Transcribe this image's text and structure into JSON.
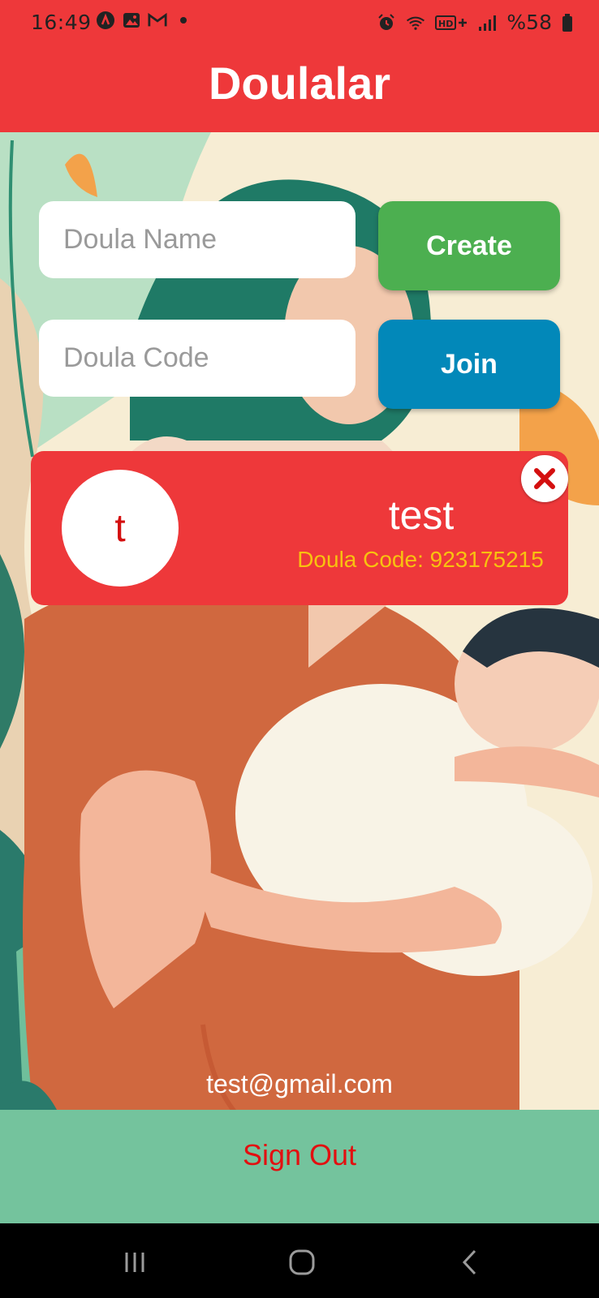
{
  "status_bar": {
    "time": "16:49",
    "battery": "%58",
    "notification_icons": [
      "app-logo-icon",
      "image-icon",
      "gmail-icon"
    ],
    "system_icons": [
      "alarm-icon",
      "wifi-icon",
      "hd-plus-icon",
      "signal-icon",
      "battery-icon"
    ]
  },
  "header": {
    "title": "Doulalar"
  },
  "form": {
    "name_placeholder": "Doula Name",
    "create_label": "Create",
    "code_placeholder": "Doula Code",
    "join_label": "Join"
  },
  "doulas": [
    {
      "initial": "t",
      "name": "test",
      "code_label": "Doula Code: 923175215"
    }
  ],
  "footer": {
    "email": "test@gmail.com",
    "sign_out_label": "Sign Out"
  },
  "colors": {
    "primary": "#ee383a",
    "create": "#4caf50",
    "join": "#0288b9",
    "code_text": "#f8c20f",
    "sign_out": "#e30f10"
  },
  "nav_bar": {
    "icons": [
      "recent-apps-icon",
      "home-icon",
      "back-icon"
    ]
  }
}
